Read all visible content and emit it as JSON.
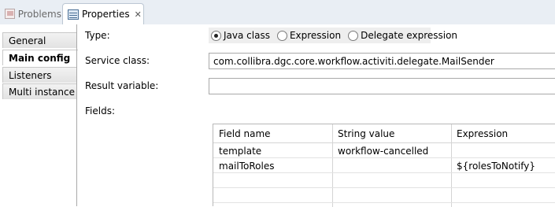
{
  "tabs": [
    {
      "label": "Problems",
      "icon": "problems-icon"
    },
    {
      "label": "Properties",
      "icon": "properties-icon",
      "close": "✕"
    }
  ],
  "sidebar": {
    "items": [
      {
        "label": "General"
      },
      {
        "label": "Main config"
      },
      {
        "label": "Listeners"
      },
      {
        "label": "Multi instance"
      }
    ]
  },
  "form": {
    "type_label": "Type:",
    "type_options": [
      "Java class",
      "Expression",
      "Delegate expression"
    ],
    "type_selected": "Java class",
    "service_class_label": "Service class:",
    "service_class_value": "com.collibra.dgc.core.workflow.activiti.delegate.MailSender",
    "result_variable_label": "Result variable:",
    "result_variable_value": "",
    "fields_label": "Fields:"
  },
  "fields_table": {
    "columns": [
      "Field name",
      "String value",
      "Expression"
    ],
    "rows": [
      [
        "template",
        "workflow-cancelled",
        ""
      ],
      [
        "mailToRoles",
        "",
        "${rolesToNotify}"
      ],
      [
        "",
        "",
        ""
      ],
      [
        "",
        "",
        ""
      ]
    ]
  }
}
